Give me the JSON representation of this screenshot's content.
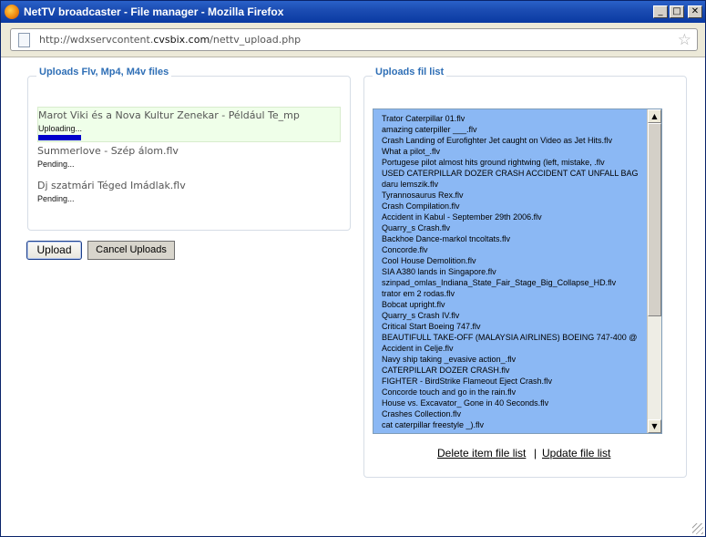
{
  "window": {
    "title": "NetTV broadcaster - File manager - Mozilla Firefox",
    "minimize_label": "_",
    "maximize_label": "□",
    "close_label": "✕"
  },
  "address": {
    "url_prefix": "http://wdxservcontent.",
    "url_domain": "cvsbix.com",
    "url_suffix": "/nettv_upload.php"
  },
  "upload_panel": {
    "title": "Uploads Flv, Mp4, M4v files",
    "queue": [
      {
        "name": "Marot Viki és a Nova Kultur Zenekar - Például Te_mp",
        "status": "Uploading...",
        "progress": 0.14
      },
      {
        "name": "Summerlove - Szép álom.flv",
        "status": "Pending..."
      },
      {
        "name": "Dj szatmári Téged Imádlak.flv",
        "status": "Pending..."
      }
    ],
    "upload_button": "Upload",
    "cancel_button": "Cancel Uploads"
  },
  "file_list_panel": {
    "title": "Uploads fil list",
    "files": [
      "Trator Caterpillar 01.flv",
      "amazing caterpiller ___.flv",
      "Crash Landing of Eurofighter Jet caught on Video as Jet Hits.flv",
      "What a pilot_.flv",
      "Portugese pilot almost hits ground rightwing (left, mistake, .flv",
      "USED CATERPILLAR DOZER CRASH ACCIDENT CAT UNFALL BAG",
      "daru lemszik.flv",
      "Tyrannosaurus Rex.flv",
      "Crash Compilation.flv",
      "Accident in Kabul - September 29th 2006.flv",
      "Quarry_s Crash.flv",
      "Backhoe Dance-markol tncoltats.flv",
      "Concorde.flv",
      "Cool House Demolition.flv",
      "SIA A380 lands in Singapore.flv",
      "szinpad_omlas_Indiana_State_Fair_Stage_Big_Collapse_HD.flv",
      "trator em 2 rodas.flv",
      "Bobcat upright.flv",
      "Quarry_s Crash IV.flv",
      "Critical Start Boeing 747.flv",
      "BEAUTIFULL TAKE-OFF (MALAYSIA AIRLINES) BOEING 747-400 @",
      "Accident in Celje.flv",
      "Navy ship taking _evasive action_.flv",
      "CATERPILLAR DOZER CRASH.flv",
      "FIGHTER - BirdStrike Flameout Eject Crash.flv",
      "Concorde touch and go in the rain.flv",
      "House vs. Excavator_ Gone in 40 Seconds.flv",
      "Crashes Collection.flv",
      "cat caterpillar freestyle _).flv"
    ],
    "delete_link": "Delete item file list",
    "separator": "|",
    "update_link": "Update file list"
  },
  "colors": {
    "title_bar": "#1c4db3",
    "panel_title": "#2f6fb6",
    "list_background": "#8bb8f4",
    "progress": "#0000cc",
    "active_row": "#efffe9"
  },
  "icons": [
    "firefox-icon",
    "page-icon",
    "bookmark-star-icon",
    "scroll-up-icon",
    "scroll-down-icon",
    "resize-grip-icon"
  ]
}
